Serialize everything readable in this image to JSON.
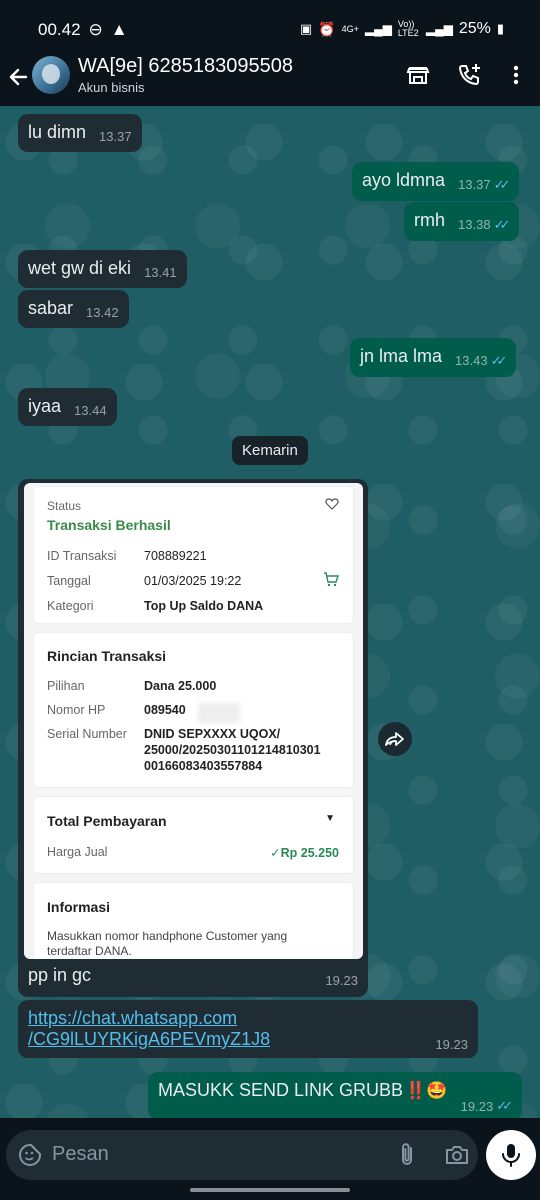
{
  "status_bar": {
    "time": "00.42",
    "battery": "25%",
    "network_label": "4G+",
    "volte_label": "Vo)) LTE2"
  },
  "header": {
    "contact_name": "WA[9e] 6285183095508",
    "subtitle": "Akun bisnis"
  },
  "messages": [
    {
      "dir": "in",
      "text": "lu dimn",
      "time": "13.37"
    },
    {
      "dir": "out",
      "text": "ayo ldmna",
      "time": "13.37"
    },
    {
      "dir": "out",
      "text": "rmh",
      "time": "13.38"
    },
    {
      "dir": "in",
      "text": "wet gw di eki",
      "time": "13.41"
    },
    {
      "dir": "in",
      "text": "sabar",
      "time": "13.42"
    },
    {
      "dir": "out",
      "text": "jn lma lma",
      "time": "13.43"
    },
    {
      "dir": "in",
      "text": "iyaa",
      "time": "13.44"
    }
  ],
  "date_chip": "Kemarin",
  "receipt": {
    "status_label": "Status",
    "status_value": "Transaksi Berhasil",
    "rows1": [
      {
        "label": "ID Transaksi",
        "value": "708889221"
      },
      {
        "label": "Tanggal",
        "value": "01/03/2025 19:22"
      },
      {
        "label": "Kategori",
        "value": "Top Up Saldo DANA"
      }
    ],
    "detail_title": "Rincian Transaksi",
    "rows2": [
      {
        "label": "Pilihan",
        "value": "Dana 25.000"
      },
      {
        "label": "Nomor HP",
        "value": "089540"
      },
      {
        "label": "Serial Number",
        "value": "DNID SEPXXXX UQOX/"
      }
    ],
    "serial_line2": "25000/20250301101214810301",
    "serial_line3": "00166083403557884",
    "total_title": "Total Pembayaran",
    "price_label": "Harga Jual",
    "price_value": "Rp 25.250",
    "info_title": "Informasi",
    "info_line1": "Masukkan nomor handphone Customer yang",
    "info_line2": "terdaftar DANA."
  },
  "image_caption": {
    "text": "pp in gc",
    "time": "19.23"
  },
  "link_message": {
    "line1": "https://chat.whatsapp.com",
    "line2": "/CG9lLUYRKigA6PEVmyZ1J8",
    "time": "19.23"
  },
  "last_message": {
    "text": "MASUKK SEND LINK GRUBB",
    "emoji": "‼️🤩",
    "time": "19.23"
  },
  "input": {
    "placeholder": "Pesan"
  },
  "colors": {
    "incoming": "#202c33",
    "outgoing": "#005c4b",
    "chat_bg": "#1f5e64",
    "link": "#53bdeb",
    "success": "#3a8a4a"
  }
}
